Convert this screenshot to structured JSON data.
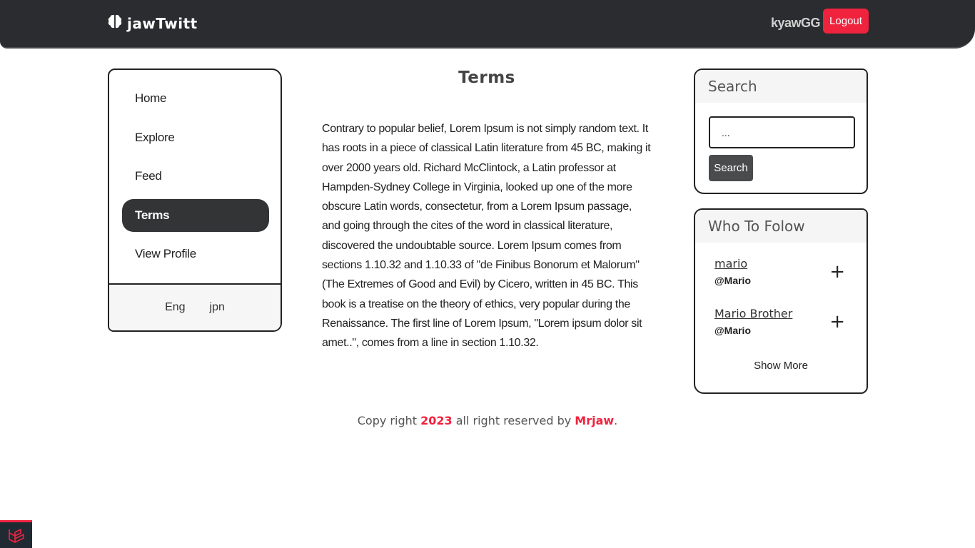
{
  "app": {
    "brand_name": "jawTwitt",
    "brand_icon": "brain-icon",
    "accent_color": "#f0233f"
  },
  "navbar": {
    "username": "kyawGG",
    "logout_label": "Logout"
  },
  "sidebar": {
    "items": [
      {
        "label": "Home",
        "active": false
      },
      {
        "label": "Explore",
        "active": false
      },
      {
        "label": "Feed",
        "active": false
      },
      {
        "label": "Terms",
        "active": true
      },
      {
        "label": "View Profile",
        "active": false
      }
    ],
    "languages": [
      "Eng",
      "jpn"
    ]
  },
  "main": {
    "title": "Terms",
    "body": "Contrary to popular belief, Lorem Ipsum is not simply random text. It has roots in a piece of classical Latin literature from 45 BC, making it over 2000 years old. Richard McClintock, a Latin professor at Hampden-Sydney College in Virginia, looked up one of the more obscure Latin words, consectetur, from a Lorem Ipsum passage, and going through the cites of the word in classical literature, discovered the undoubtable source. Lorem Ipsum comes from sections 1.10.32 and 1.10.33 of \"de Finibus Bonorum et Malorum\" (The Extremes of Good and Evil) by Cicero, written in 45 BC. This book is a treatise on the theory of ethics, very popular during the Renaissance. The first line of Lorem Ipsum, \"Lorem ipsum dolor sit amet..\", comes from a line in section 1.10.32."
  },
  "search": {
    "title": "Search",
    "input_value": "...",
    "button_label": "Search"
  },
  "follow": {
    "title": "Who To Folow",
    "users": [
      {
        "name": "mario",
        "handle": "@Mario"
      },
      {
        "name": "Mario Brother",
        "handle": "@Mario"
      }
    ],
    "show_more_label": "Show More"
  },
  "footer": {
    "prefix": "Copy right ",
    "year": "2023",
    "middle": " all right reserved by ",
    "author": "Mrjaw",
    "suffix": "."
  }
}
